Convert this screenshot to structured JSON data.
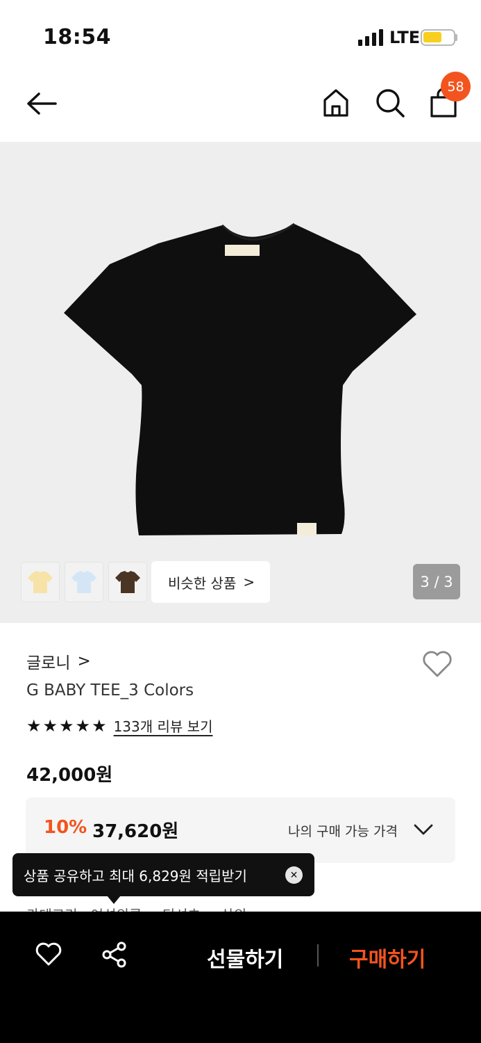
{
  "status_bar": {
    "time": "18:54",
    "network": "LTE"
  },
  "header": {
    "cart_count": "58"
  },
  "gallery": {
    "similar_label": "비슷한 상품",
    "similar_chevron": ">",
    "page_indicator": "3 / 3",
    "thumbnails": [
      {
        "color": "#f7e3a8"
      },
      {
        "color": "#d4e6f5"
      },
      {
        "color": "#4a3424"
      }
    ]
  },
  "product": {
    "brand": "글로니",
    "brand_chevron": ">",
    "title": "G BABY TEE_3 Colors",
    "rating_stars": 5,
    "review_link": "133개 리뷰 보기",
    "list_price": "42,000원"
  },
  "discount": {
    "rate": "10%",
    "price": "37,620원",
    "my_price_label": "나의 구매 가능 가격"
  },
  "category": {
    "text": "카테고리 · 여성의류 > 티셔츠 > 상의"
  },
  "toast": {
    "message": "상품 공유하고 최대 6,829원 적립받기",
    "close_symbol": "✕"
  },
  "bottom_bar": {
    "gift_label": "선물하기",
    "buy_label": "구매하기"
  },
  "colors": {
    "accent": "#f3541f",
    "badge": "#f3541f",
    "battery": "#f8cf1e"
  }
}
